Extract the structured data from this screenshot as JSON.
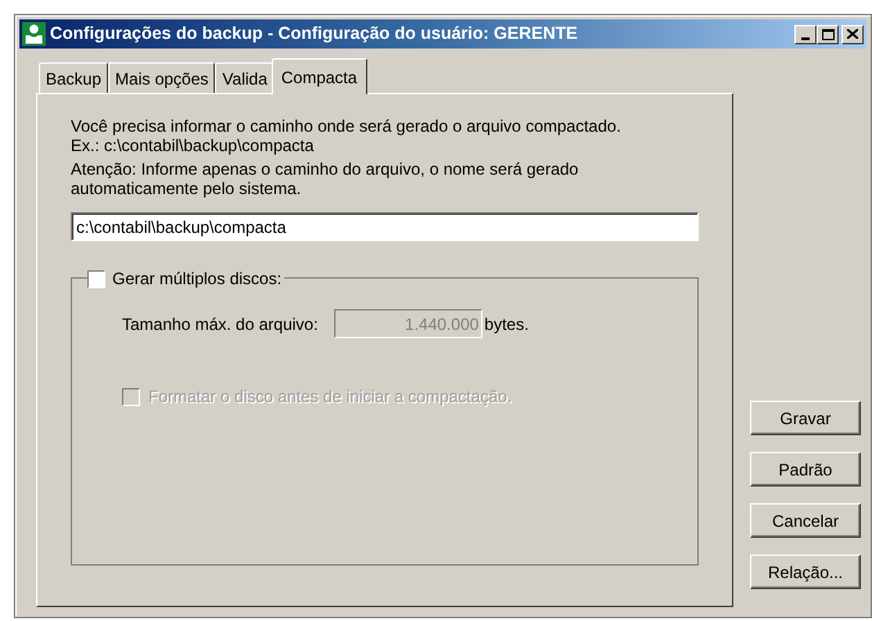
{
  "window": {
    "title": "Configurações do backup - Configuração do usuário: GERENTE"
  },
  "tabs": [
    {
      "label": "Backup",
      "selected": false
    },
    {
      "label": "Mais opções",
      "selected": false
    },
    {
      "label": "Valida",
      "selected": false
    },
    {
      "label": "Compacta",
      "selected": true
    }
  ],
  "instructions": [
    "Você precisa informar o caminho onde será gerado o arquivo compactado.",
    "Ex.: c:\\contabil\\backup\\compacta"
  ],
  "attention": "Atenção: Informe apenas o caminho do arquivo, o nome será gerado automaticamente pelo sistema.",
  "path_field": {
    "value": "c:\\contabil\\backup\\compacta"
  },
  "multiple_disks": {
    "label": "Gerar múltiplos discos:",
    "checked": false,
    "size_label": "Tamanho máx. do arquivo:",
    "size_value": "1.440.000",
    "size_unit": "bytes.",
    "size_disabled": true,
    "format": {
      "label": "Formatar o disco antes de iniciar a compactação.",
      "checked": false,
      "disabled": true
    }
  },
  "buttons": [
    "Gravar",
    "Padrão",
    "Cancelar",
    "Relação..."
  ]
}
